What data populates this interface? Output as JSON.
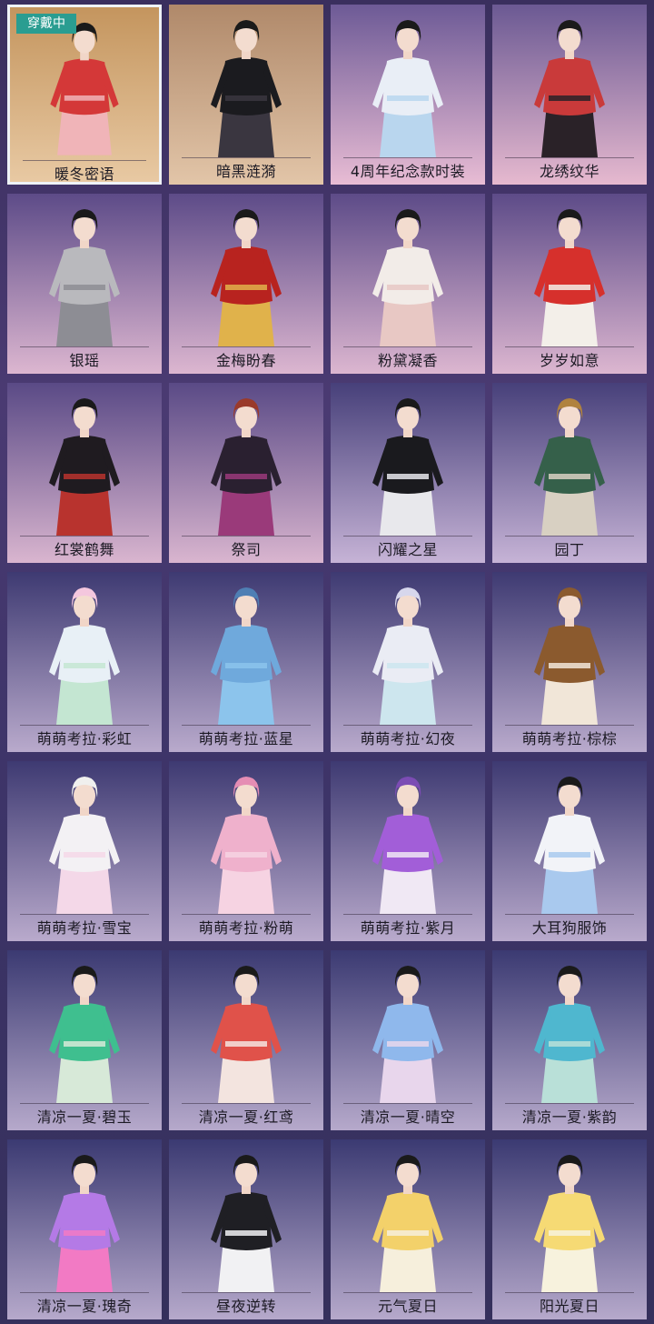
{
  "equipped_badge": "穿戴中",
  "outfits": [
    {
      "name": "暖冬密语",
      "bg": [
        "#c4955e",
        "#e8c9a3"
      ],
      "outfit": [
        "#d43838",
        "#f0b4b8"
      ],
      "hair": "#1a1a1a",
      "selected": true
    },
    {
      "name": "暗黑涟漪",
      "bg": [
        "#b0896a",
        "#e2c5a8"
      ],
      "outfit": [
        "#1b1b1f",
        "#3a3640"
      ],
      "hair": "#1a1a1a"
    },
    {
      "name": "4周年纪念款时装",
      "bg": [
        "#6d5a96",
        "#e8bcd4"
      ],
      "outfit": [
        "#e9eef6",
        "#b9d6ee"
      ],
      "hair": "#1a1a1a"
    },
    {
      "name": "龙绣纹华",
      "bg": [
        "#6b5993",
        "#e6b9cf"
      ],
      "outfit": [
        "#c93a3a",
        "#2a2228"
      ],
      "hair": "#1a1a1a"
    },
    {
      "name": "银瑶",
      "bg": [
        "#5d4b88",
        "#dcb6d0"
      ],
      "outfit": [
        "#b9b9bd",
        "#8d8d94"
      ],
      "hair": "#1a1a1a"
    },
    {
      "name": "金梅盼春",
      "bg": [
        "#5d4b88",
        "#dcb6d0"
      ],
      "outfit": [
        "#b8231f",
        "#e0b24b"
      ],
      "hair": "#1a1a1a"
    },
    {
      "name": "粉黛凝香",
      "bg": [
        "#5d4b88",
        "#dcb6d0"
      ],
      "outfit": [
        "#f2ece8",
        "#e8c8c4"
      ],
      "hair": "#1a1a1a"
    },
    {
      "name": "岁岁如意",
      "bg": [
        "#5d4b88",
        "#dcb6d0"
      ],
      "outfit": [
        "#d6302c",
        "#f3efe9"
      ],
      "hair": "#1a1a1a"
    },
    {
      "name": "红裳鹤舞",
      "bg": [
        "#5a4a86",
        "#d9b5cf"
      ],
      "outfit": [
        "#1f1b20",
        "#b8332e"
      ],
      "hair": "#1a1a1a"
    },
    {
      "name": "祭司",
      "bg": [
        "#5a4a86",
        "#d9b5cf"
      ],
      "outfit": [
        "#2a2030",
        "#9a3a7a"
      ],
      "hair": "#9a3a2a"
    },
    {
      "name": "闪耀之星",
      "bg": [
        "#47407a",
        "#c6b3d6"
      ],
      "outfit": [
        "#1a1a1e",
        "#e8e8ec"
      ],
      "hair": "#1a1a1a"
    },
    {
      "name": "园丁",
      "bg": [
        "#47407a",
        "#c6b3d6"
      ],
      "outfit": [
        "#35604a",
        "#d8d0c2"
      ],
      "hair": "#b0823e"
    },
    {
      "name": "萌萌考拉·彩虹",
      "bg": [
        "#3e3a72",
        "#b9aacc"
      ],
      "outfit": [
        "#e8f0f6",
        "#c4e6d2"
      ],
      "hair": "#f4c7de"
    },
    {
      "name": "萌萌考拉·蓝星",
      "bg": [
        "#3e3a72",
        "#b9aacc"
      ],
      "outfit": [
        "#6fa9dc",
        "#8cc4ec"
      ],
      "hair": "#4f7fb4"
    },
    {
      "name": "萌萌考拉·幻夜",
      "bg": [
        "#3e3a72",
        "#b9aacc"
      ],
      "outfit": [
        "#eaecf4",
        "#cde6ee"
      ],
      "hair": "#d7d7ec"
    },
    {
      "name": "萌萌考拉·棕棕",
      "bg": [
        "#3e3a72",
        "#b9aacc"
      ],
      "outfit": [
        "#8b5a2e",
        "#f1e6d8"
      ],
      "hair": "#8b5a2e"
    },
    {
      "name": "萌萌考拉·雪宝",
      "bg": [
        "#3e3a72",
        "#b9aacc"
      ],
      "outfit": [
        "#f3f1f4",
        "#f4d8e8"
      ],
      "hair": "#f0f0ee"
    },
    {
      "name": "萌萌考拉·粉萌",
      "bg": [
        "#3e3a72",
        "#b9aacc"
      ],
      "outfit": [
        "#efb1cc",
        "#f6d3e2"
      ],
      "hair": "#e58db4"
    },
    {
      "name": "萌萌考拉·紫月",
      "bg": [
        "#3e3a72",
        "#b9aacc"
      ],
      "outfit": [
        "#a25ed8",
        "#f0e8f4"
      ],
      "hair": "#7c4cb4"
    },
    {
      "name": "大耳狗服饰",
      "bg": [
        "#3e3a72",
        "#b9aacc"
      ],
      "outfit": [
        "#f2f3f8",
        "#a9c9ee"
      ],
      "hair": "#1a1a1a"
    },
    {
      "name": "清凉一夏·碧玉",
      "bg": [
        "#3b3a72",
        "#b6a9cb"
      ],
      "outfit": [
        "#3fbf8f",
        "#d7e9d8"
      ],
      "hair": "#1a1a1a"
    },
    {
      "name": "清凉一夏·红鸢",
      "bg": [
        "#3b3a72",
        "#b6a9cb"
      ],
      "outfit": [
        "#e0524a",
        "#f3e4df"
      ],
      "hair": "#1a1a1a"
    },
    {
      "name": "清凉一夏·晴空",
      "bg": [
        "#3b3a72",
        "#b6a9cb"
      ],
      "outfit": [
        "#8fb8ec",
        "#e8d6ec"
      ],
      "hair": "#1a1a1a"
    },
    {
      "name": "清凉一夏·紫韵",
      "bg": [
        "#3b3a72",
        "#b6a9cb"
      ],
      "outfit": [
        "#4fb7cf",
        "#b9e0d8"
      ],
      "hair": "#1a1a1a"
    },
    {
      "name": "清凉一夏·瑰奇",
      "bg": [
        "#3b3a72",
        "#b6a9cb"
      ],
      "outfit": [
        "#b47ae6",
        "#f27ac4"
      ],
      "hair": "#1a1a1a"
    },
    {
      "name": "昼夜逆转",
      "bg": [
        "#3b3a72",
        "#b6a9cb"
      ],
      "outfit": [
        "#1f1f24",
        "#f1f1f3"
      ],
      "hair": "#1a1a1a"
    },
    {
      "name": "元气夏日",
      "bg": [
        "#3b3a72",
        "#b6a9cb"
      ],
      "outfit": [
        "#f3d16a",
        "#f6efdc"
      ],
      "hair": "#1a1a1a"
    },
    {
      "name": "阳光夏日",
      "bg": [
        "#3b3a72",
        "#b6a9cb"
      ],
      "outfit": [
        "#f6da74",
        "#f7f2dd"
      ],
      "hair": "#1a1a1a"
    }
  ]
}
